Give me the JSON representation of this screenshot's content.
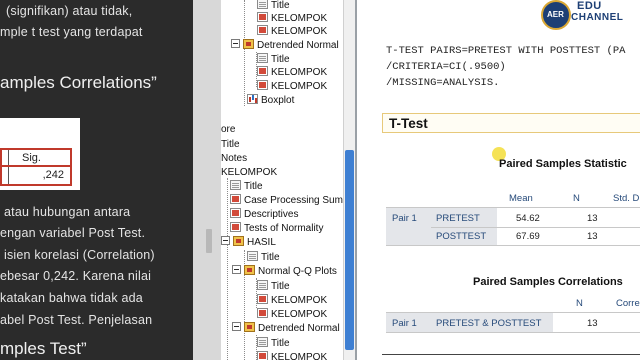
{
  "left_panel": {
    "lines": [
      "(signifikan) atau tidak,",
      "mple t test yang terdapat",
      "atau hubungan antara",
      "engan variabel Post Test.",
      "isien korelasi (Correlation)",
      "ebesar 0,242. Karena nilai",
      "katakan bahwa tidak ada",
      "abel Post Test. Penjelasan"
    ],
    "heading1": "amples Correlations”",
    "heading2": "mples Test”",
    "table": {
      "header": "Sig.",
      "value": ",242"
    }
  },
  "tree": {
    "items": [
      {
        "label": "Title",
        "icon": "doc"
      },
      {
        "label": "KELOMPOK",
        "icon": "red"
      },
      {
        "label": "KELOMPOK",
        "icon": "red"
      },
      {
        "label": "Detrended Normal",
        "icon": "book"
      },
      {
        "label": "Title",
        "icon": "doc"
      },
      {
        "label": "KELOMPOK",
        "icon": "red"
      },
      {
        "label": "KELOMPOK",
        "icon": "red"
      },
      {
        "label": "Boxplot",
        "icon": "chart"
      },
      {
        "label": "ore"
      },
      {
        "label": "Title"
      },
      {
        "label": "Notes"
      },
      {
        "label": "KELOMPOK"
      },
      {
        "label": "Title",
        "icon": "doc"
      },
      {
        "label": "Case Processing Sum",
        "icon": "red"
      },
      {
        "label": "Descriptives",
        "icon": "red"
      },
      {
        "label": "Tests of Normality",
        "icon": "red"
      },
      {
        "label": "HASIL",
        "icon": "book"
      },
      {
        "label": "Title",
        "icon": "doc"
      },
      {
        "label": "Normal Q-Q Plots",
        "icon": "book"
      },
      {
        "label": "Title",
        "icon": "doc"
      },
      {
        "label": "KELOMPOK",
        "icon": "red"
      },
      {
        "label": "KELOMPOK",
        "icon": "red"
      },
      {
        "label": "Detrended Normal",
        "icon": "book"
      },
      {
        "label": "Title",
        "icon": "doc"
      },
      {
        "label": "KELOMPOK",
        "icon": "red"
      }
    ]
  },
  "output": {
    "logo": {
      "seal": "AER",
      "line1": "EDU",
      "line2": "CHANNEL"
    },
    "syntax": [
      "T-TEST PAIRS=PRETEST WITH POSTTEST (PA",
      "  /CRITERIA=CI(.9500)",
      "  /MISSING=ANALYSIS."
    ],
    "ttest_title": "T-Test",
    "stats_table": {
      "title": "Paired Samples Statistic",
      "headers": [
        "Mean",
        "N",
        "Std. D"
      ],
      "pair_label": "Pair 1",
      "rows": [
        {
          "name": "PRETEST",
          "mean": "54.62",
          "n": "13"
        },
        {
          "name": "POSTTEST",
          "mean": "67.69",
          "n": "13"
        }
      ]
    },
    "corr_table": {
      "title": "Paired Samples Correlations",
      "headers": [
        "N",
        "Corre"
      ],
      "pair_label": "Pair 1",
      "row": {
        "name": "PRETEST & POSTTEST",
        "n": "13"
      }
    }
  },
  "colors": {
    "accent_blue": "#3e7fd2",
    "left_bg": "#2b2b2b",
    "highlight": "#f4e04d"
  }
}
